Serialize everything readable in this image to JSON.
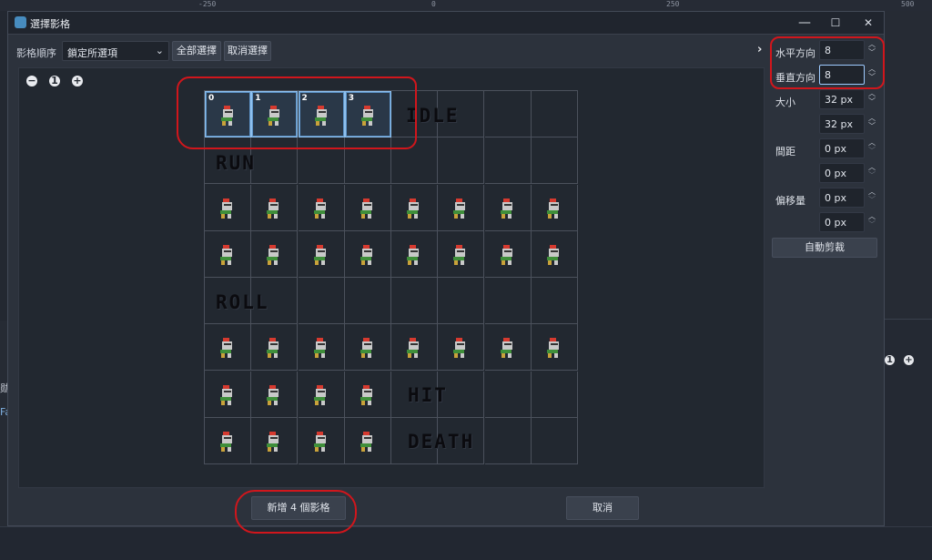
{
  "background": {
    "ruler_ticks": [
      "-250",
      "0",
      "250",
      "500"
    ],
    "left_fragment": "Fa",
    "left_fragment2": "勋"
  },
  "dialog": {
    "title": "選擇影格",
    "window_buttons": {
      "minimize": "—",
      "maximize": "☐",
      "close": "✕"
    }
  },
  "toolbar": {
    "order_label": "影格順序",
    "order_value": "鎖定所選項",
    "select_all": "全部選擇",
    "deselect": "取消選擇"
  },
  "zoom": {
    "out": "−",
    "reset": "1",
    "in": "+"
  },
  "grid": {
    "rows": 8,
    "cols": 8,
    "selected_indices": [
      "0",
      "1",
      "2",
      "3"
    ],
    "labels": {
      "idle": "IDLE",
      "run": "RUN",
      "roll": "ROLL",
      "hit": "HIT",
      "death": "DEATH"
    }
  },
  "side": {
    "horizontal_label": "水平方向",
    "horizontal_value": "8",
    "vertical_label": "垂直方向",
    "vertical_value": "8",
    "size_label": "大小",
    "size_x": "32 px",
    "size_y": "32 px",
    "separation_label": "間距",
    "sep_x": "0 px",
    "sep_y": "0 px",
    "offset_label": "偏移量",
    "off_x": "0 px",
    "off_y": "0 px",
    "auto_slice": "自動剪裁"
  },
  "footer": {
    "add_frames": "新增 4 個影格",
    "cancel": "取消"
  },
  "colors": {
    "selection": "#8fc1ef",
    "annotation": "#d1161c",
    "sprite_red": "#d63a2f",
    "sprite_green": "#3f8f3a",
    "sprite_grey": "#c9c9c9"
  }
}
